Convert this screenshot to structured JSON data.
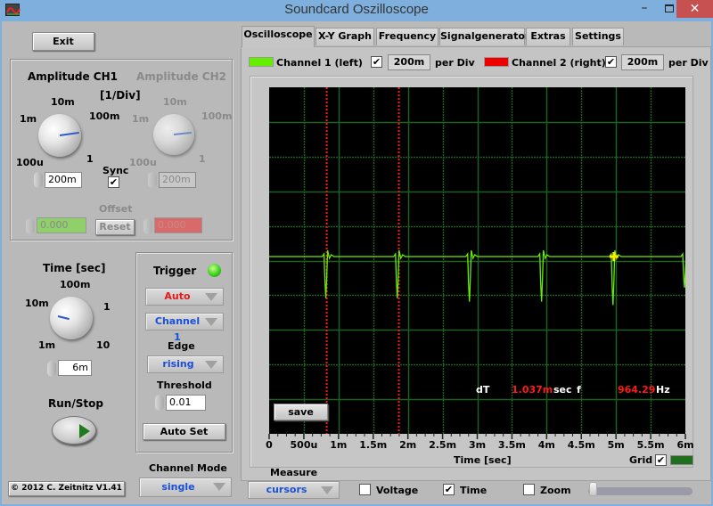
{
  "window": {
    "title": "Soundcard Oszilloscope",
    "icons": {
      "app": "oscilloscope-app-icon",
      "minimize": "minimize-icon",
      "maximize": "maximize-icon",
      "close": "close-icon"
    },
    "minimize_glyph": "–",
    "close_glyph": "✕"
  },
  "left": {
    "exit_label": "Exit",
    "amplitude": {
      "ch1_title": "Amplitude CH1",
      "ch2_title": "Amplitude CH2",
      "unit_label": "[1/Div]",
      "scale_labels": [
        "100u",
        "1m",
        "10m",
        "100m",
        "1"
      ],
      "ch1_value": "200m",
      "ch2_value": "200m",
      "sync_label": "Sync",
      "sync_checked": true,
      "offset_label": "Offset",
      "offset_ch1": "0.000",
      "offset_ch2": "0.000",
      "reset_label": "Reset"
    },
    "time": {
      "title": "Time [sec]",
      "scale_labels": [
        "1m",
        "10m",
        "100m",
        "1",
        "10"
      ],
      "value": "6m"
    },
    "run_stop_label": "Run/Stop",
    "copyright": "© 2012  C. Zeitnitz V1.41",
    "trigger": {
      "title": "Trigger",
      "mode": "Auto",
      "channel": "Channel 1",
      "edge_label": "Edge",
      "edge": "rising",
      "threshold_label": "Threshold",
      "threshold": "0.01",
      "autoset_label": "Auto Set",
      "led_color": "#3ed11c"
    },
    "channel_mode": {
      "label": "Channel Mode",
      "value": "single"
    }
  },
  "tabs": [
    "Oscilloscope",
    "X-Y Graph",
    "Frequency",
    "Signalgenerator",
    "Extras",
    "Settings"
  ],
  "active_tab": 0,
  "channels": {
    "ch1_label": "Channel 1 (left)",
    "ch1_color": "#66ee00",
    "ch1_enabled": true,
    "ch1_scale": "200m",
    "ch2_label": "Channel 2 (right)",
    "ch2_color": "#ee0000",
    "ch2_enabled": true,
    "ch2_scale": "200m",
    "per_div": "per Div"
  },
  "scope": {
    "save_label": "save",
    "dT_label": "dT",
    "dT_value": "1.037m",
    "dT_unit": "sec",
    "f_label": "f",
    "f_value": "964.29",
    "f_unit": "Hz",
    "grid_label": "Grid",
    "grid_checked": true,
    "grid_color": "#1f5f1f"
  },
  "chart_data": {
    "type": "line",
    "title": "",
    "xlabel": "Time [sec]",
    "ylabel": "",
    "x_range": [
      0,
      0.006
    ],
    "y_divisions": 10,
    "x_tick_labels": [
      "0",
      "500u",
      "1m",
      "1.5m",
      "2m",
      "2.5m",
      "3m",
      "3.5m",
      "4m",
      "4.5m",
      "5m",
      "5.5m",
      "6m"
    ],
    "grid": true,
    "cursors_x": [
      0.00083,
      0.00187
    ],
    "series": [
      {
        "name": "Channel 1 (left)",
        "baseline_div": 0.5,
        "pulse_times": [
          0.00083,
          0.00186,
          0.0029,
          0.00394,
          0.00497,
          0.006
        ],
        "pulse_depth_div": [
          1.2,
          1.2,
          1.3,
          1.3,
          1.4,
          0.9
        ]
      }
    ],
    "marker": {
      "x": 0.00497,
      "label": "cursor-cross"
    }
  },
  "bottom": {
    "measure_label": "Measure",
    "measure_value": "cursors",
    "voltage_label": "Voltage",
    "voltage_checked": false,
    "time_label": "Time",
    "time_checked": true,
    "zoom_label": "Zoom",
    "zoom_checked": false,
    "zoom_slider_value": 0
  }
}
